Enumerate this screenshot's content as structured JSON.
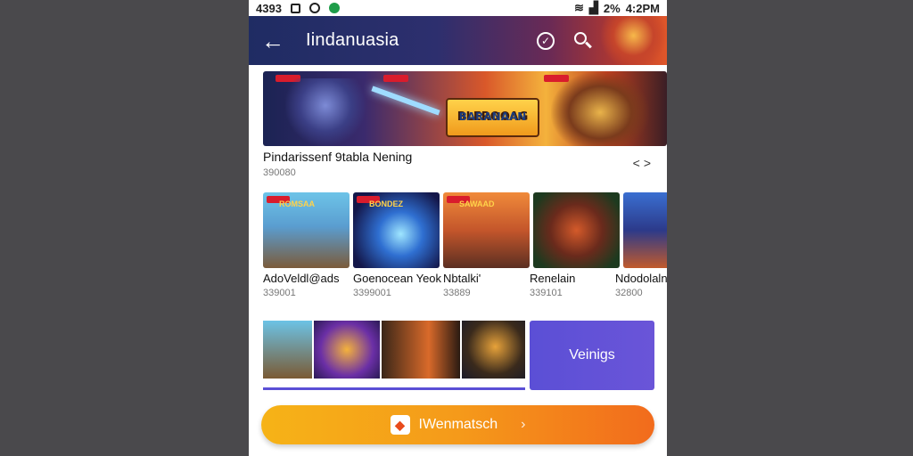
{
  "status_bar": {
    "time_left": "4393",
    "battery": "2%",
    "time_right": "4:2PM"
  },
  "app_bar": {
    "back_icon": "back-arrow-icon",
    "title": "Iindanuasia",
    "check_icon": "check-circle-icon",
    "search_icon": "search-icon"
  },
  "banner": {
    "logo_line1": "BLEROOAG",
    "logo_line2": "BARANAAN"
  },
  "featured": {
    "title": "Pindarissenf 9tabla Nening",
    "subtitle": "390080",
    "nav_label": "<>"
  },
  "games": [
    {
      "tile_text": "ROMSAA",
      "label": "AdoVeldl@ads",
      "sub": "339001"
    },
    {
      "tile_text": "BONDEZ",
      "label": "Goenocean Yeok",
      "sub": "3399001"
    },
    {
      "tile_text": "SAWAAD",
      "label": "Nbtalki'",
      "sub": "33889"
    },
    {
      "tile_text": "",
      "label": "Renelain",
      "sub": "339101"
    },
    {
      "tile_text": "",
      "label": "Ndodolaln",
      "sub": "32800"
    }
  ],
  "promo": {
    "label": "Veinigs"
  },
  "cta": {
    "label": "IWenmatsch",
    "arrow": "›",
    "icon": "tag-icon"
  }
}
